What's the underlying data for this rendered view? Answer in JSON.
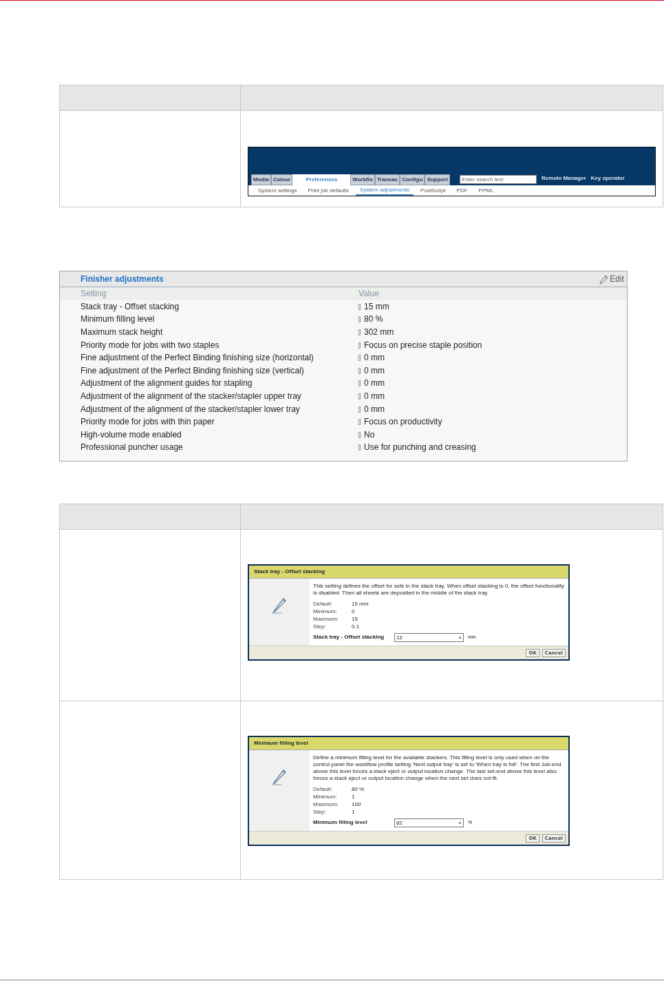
{
  "navbar_screenshot": {
    "tabs": [
      {
        "label": "Media",
        "selected": false
      },
      {
        "label": "Colour",
        "selected": false
      },
      {
        "label": "Preferences",
        "selected": true
      },
      {
        "label": "Workflo",
        "selected": false
      },
      {
        "label": "Transac",
        "selected": false
      },
      {
        "label": "Configu",
        "selected": false
      },
      {
        "label": "Support",
        "selected": false
      }
    ],
    "search": {
      "placeholder": "Enter search text"
    },
    "links": [
      "Remote Manager",
      "Key operator"
    ],
    "subtabs": [
      {
        "label": "System settings",
        "selected": false
      },
      {
        "label": "Print job defaults",
        "selected": false
      },
      {
        "label": "System adjustments",
        "selected": true
      },
      {
        "label": "PostScript",
        "selected": false
      },
      {
        "label": "PDF",
        "selected": false
      },
      {
        "label": "PPML",
        "selected": false
      }
    ]
  },
  "finisher_panel": {
    "title": "Finisher adjustments",
    "edit": "Edit",
    "columns": [
      "Setting",
      "Value"
    ],
    "rows": [
      {
        "setting": "Stack tray - Offset stacking",
        "value": "15 mm"
      },
      {
        "setting": "Minimum filling level",
        "value": "80 %"
      },
      {
        "setting": "Maximum stack height",
        "value": "302 mm"
      },
      {
        "setting": "Priority mode for jobs with two staples",
        "value": "Focus on precise staple position"
      },
      {
        "setting": "Fine adjustment of the Perfect Binding finishing size (horizontal)",
        "value": "0 mm"
      },
      {
        "setting": "Fine adjustment of the Perfect Binding finishing size (vertical)",
        "value": "0 mm"
      },
      {
        "setting": "Adjustment of the alignment guides for stapling",
        "value": "0 mm"
      },
      {
        "setting": "Adjustment of the alignment of the stacker/stapler upper tray",
        "value": "0 mm"
      },
      {
        "setting": "Adjustment of the alignment of the stacker/stapler lower tray",
        "value": "0 mm"
      },
      {
        "setting": "Priority mode for jobs with thin paper",
        "value": "Focus on productivity"
      },
      {
        "setting": "High-volume mode enabled",
        "value": "No"
      },
      {
        "setting": "Professional puncher usage",
        "value": "Use for punching and creasing"
      }
    ]
  },
  "dialogs": [
    {
      "title": "Stack tray - Offset stacking",
      "description": "This setting defines the offset for sets in the stack tray. When offset stacking is 0, the offset functionality is disabled. Then all sheets are deposited in the middle of the stack tray.",
      "specs": [
        {
          "label": "Default:",
          "value": "15 mm"
        },
        {
          "label": "Minimum:",
          "value": "0"
        },
        {
          "label": "Maximum:",
          "value": "15"
        },
        {
          "label": "Step:",
          "value": "0.1"
        }
      ],
      "field_label": "Stack tray - Offset stacking",
      "value": "12",
      "clear": "×",
      "unit": "mm",
      "buttons": [
        "OK",
        "Cancel"
      ]
    },
    {
      "title": "Minimum filling level",
      "description": "Define a minimum filling level for the available stackers. This filling level is only used when on the control panel the workflow profile setting 'Next output tray' is set to 'When tray is full'. The first Job-end above this level forces a stack eject or output location change. The last set-end above this level also forces a stack eject or output location change when the next set does not fit.",
      "specs": [
        {
          "label": "Default:",
          "value": "80 %"
        },
        {
          "label": "Minimum:",
          "value": "1"
        },
        {
          "label": "Maximum:",
          "value": "100"
        },
        {
          "label": "Step:",
          "value": "1"
        }
      ],
      "field_label": "Minimum filling level",
      "value": "82",
      "clear": "×",
      "unit": "%",
      "buttons": [
        "OK",
        "Cancel"
      ]
    }
  ]
}
